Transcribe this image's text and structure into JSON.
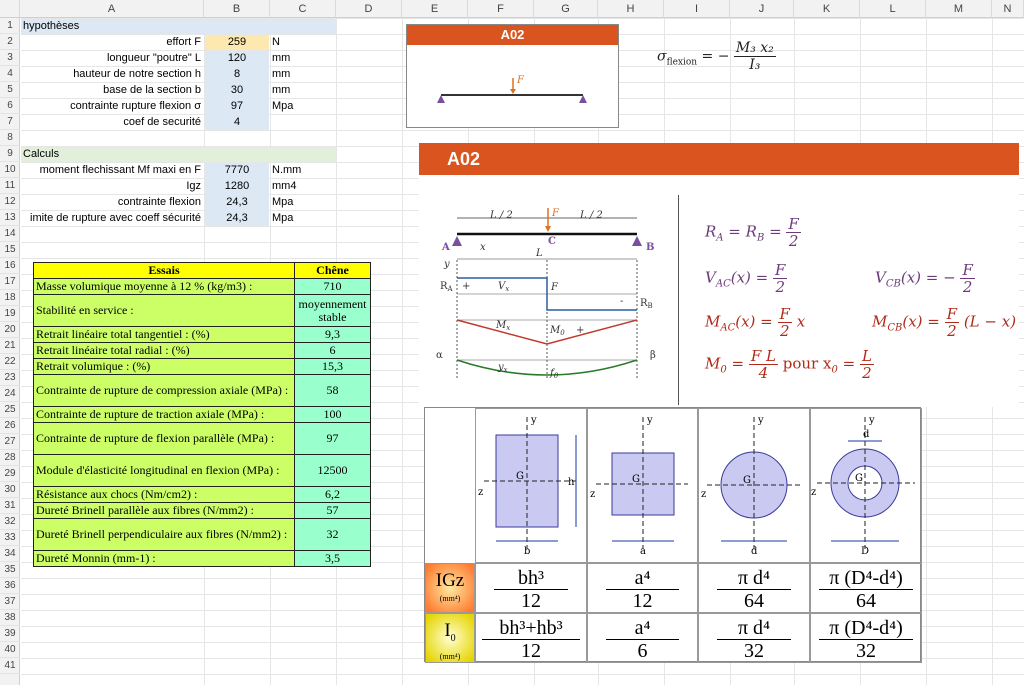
{
  "columns": [
    "A",
    "B",
    "C",
    "D",
    "E",
    "F",
    "G",
    "H",
    "I",
    "J",
    "K",
    "L",
    "M",
    "N"
  ],
  "rows": [
    "1",
    "2",
    "3",
    "4",
    "5",
    "6",
    "7",
    "8",
    "9",
    "10",
    "11",
    "12",
    "13",
    "14",
    "15",
    "16",
    "17",
    "18",
    "19",
    "20",
    "21",
    "22",
    "23",
    "24",
    "25",
    "26",
    "27",
    "28",
    "29",
    "30",
    "31",
    "32",
    "33",
    "34",
    "35",
    "36",
    "37",
    "38",
    "39",
    "40",
    "41"
  ],
  "hypotheses": {
    "title": "hypothèses",
    "items": [
      {
        "label": "effort F",
        "value": "259",
        "unit": "N"
      },
      {
        "label": "longueur \"poutre\" L",
        "value": "120",
        "unit": "mm"
      },
      {
        "label": "hauteur de notre section h",
        "value": "8",
        "unit": "mm"
      },
      {
        "label": "base de la section b",
        "value": "30",
        "unit": "mm"
      },
      {
        "label": "contrainte rupture flexion σ",
        "value": "97",
        "unit": "Mpa"
      },
      {
        "label": "coef de securité",
        "value": "4",
        "unit": ""
      }
    ]
  },
  "calculs": {
    "title": "Calculs",
    "items": [
      {
        "label": "moment flechissant Mf maxi en F",
        "value": "7770",
        "unit": "N.mm"
      },
      {
        "label": "Igz",
        "value": "1280",
        "unit": "mm4"
      },
      {
        "label": "contrainte flexion",
        "value": "24,3",
        "unit": "Mpa"
      },
      {
        "label": "imite de rupture avec coeff sécurité",
        "value": "24,3",
        "unit": "Mpa"
      }
    ]
  },
  "essais": {
    "header_label": "Essais",
    "header_value": "Chêne",
    "rows": [
      {
        "label": "Masse volumique moyenne à 12 % (kg/m3) :",
        "value": "710"
      },
      {
        "label": "Stabilité en service :",
        "value": "moyennement stable"
      },
      {
        "label": "Retrait linéaire total tangentiel : (%)",
        "value": "9,3"
      },
      {
        "label": "Retrait linéaire total radial : (%)",
        "value": "6"
      },
      {
        "label": "Retrait volumique : (%)",
        "value": "15,3"
      },
      {
        "label": "Contrainte de rupture de compression axiale (MPa) :",
        "value": "58"
      },
      {
        "label": "Contrainte de rupture de traction axiale (MPa) :",
        "value": "100"
      },
      {
        "label": "Contrainte de rupture de flexion parallèle (MPa) :",
        "value": "97"
      },
      {
        "label": "Module d'élasticité longitudinal en flexion (MPa) :",
        "value": "12500"
      },
      {
        "label": "Résistance aux chocs (Nm/cm2) :",
        "value": "6,2"
      },
      {
        "label": "Dureté Brinell parallèle aux fibres (N/mm2) :",
        "value": "57"
      },
      {
        "label": "Dureté Brinell perpendiculaire aux fibres (N/mm2) :",
        "value": "32"
      },
      {
        "label": "Dureté Monnin (mm-1) :",
        "value": "3,5"
      }
    ]
  },
  "panel_small": {
    "title": "A02",
    "load": "F"
  },
  "sigma_formula": {
    "lhs": "σ",
    "sub": "flexion",
    "num": "M₃ x₂",
    "den": "I₃"
  },
  "panel_big": {
    "title": "A02"
  },
  "beam": {
    "half_left": "L / 2",
    "half_right": "L / 2",
    "force": "F",
    "point_a": "A",
    "point_b": "B",
    "point_c": "C",
    "x": "x",
    "L": "L",
    "y": "y",
    "Ra": "R",
    "Ra_sub": "A",
    "Rb": "R",
    "Rb_sub": "B",
    "Vx": "V",
    "Vx_sub": "x",
    "F2": "F",
    "Mx": "M",
    "Mx_sub": "x",
    "M0": "M",
    "M0_sub": "0",
    "yx": "y",
    "yx_sub": "x",
    "f0": "f",
    "f0_sub": "0",
    "alpha": "α",
    "beta": "β",
    "plus": "+",
    "minus": "-"
  },
  "formulas": {
    "ra_rb": {
      "lhs": "R",
      "sub1": "A",
      "eq": " = R",
      "sub2": "B",
      "eq2": " = ",
      "num": "F",
      "den": "2"
    },
    "vac": {
      "lhs": "V",
      "sub": "AC",
      "arg": "(x) = ",
      "num": "F",
      "den": "2"
    },
    "vcb": {
      "lhs": "V",
      "sub": "CB",
      "arg": "(x) = −",
      "num": "F",
      "den": "2"
    },
    "mac": {
      "lhs": "M",
      "sub": "AC",
      "arg": "(x) = ",
      "num": "F",
      "den": "2",
      "tail": " x"
    },
    "mcb": {
      "lhs": "M",
      "sub": "CB",
      "arg": "(x) = ",
      "num": "F",
      "den": "2",
      "tail": " (L − x)"
    },
    "m0": {
      "lhs": "M",
      "sub": "0",
      "eq": " = ",
      "num": "F L",
      "den": "4",
      "mid": " pour  x",
      "sub2": "0",
      "eq2": " = ",
      "num2": "L",
      "den2": "2"
    }
  },
  "sections": {
    "shapes": [
      "b",
      "a",
      "d",
      "D"
    ],
    "axis_y": "y",
    "axis_z": "z",
    "centre": "G",
    "h": "h",
    "d_inner": "d",
    "igz_label": "IGz",
    "igz_unit": "(mm⁴)",
    "i0_label": "I",
    "i0_sub": "0",
    "i0_unit": "(mm⁴)",
    "igz": [
      {
        "num": "bh³",
        "den": "12"
      },
      {
        "num": "a⁴",
        "den": "12"
      },
      {
        "num": "π d⁴",
        "den": "64"
      },
      {
        "num": "π (D⁴-d⁴)",
        "den": "64"
      }
    ],
    "i0": [
      {
        "num": "bh³+hb³",
        "den": "12"
      },
      {
        "num": "a⁴",
        "den": "6"
      },
      {
        "num": "π d⁴",
        "den": "32"
      },
      {
        "num": "π (D⁴-d⁴)",
        "den": "32"
      }
    ]
  },
  "colors": {
    "orange": "#d9541e",
    "header_bg": "#f2f2f2",
    "hyp_band": "#dce9f5",
    "calc_band": "#e2efda",
    "input_cell": "#fde9b0",
    "calc_cell": "#dce9f5"
  }
}
